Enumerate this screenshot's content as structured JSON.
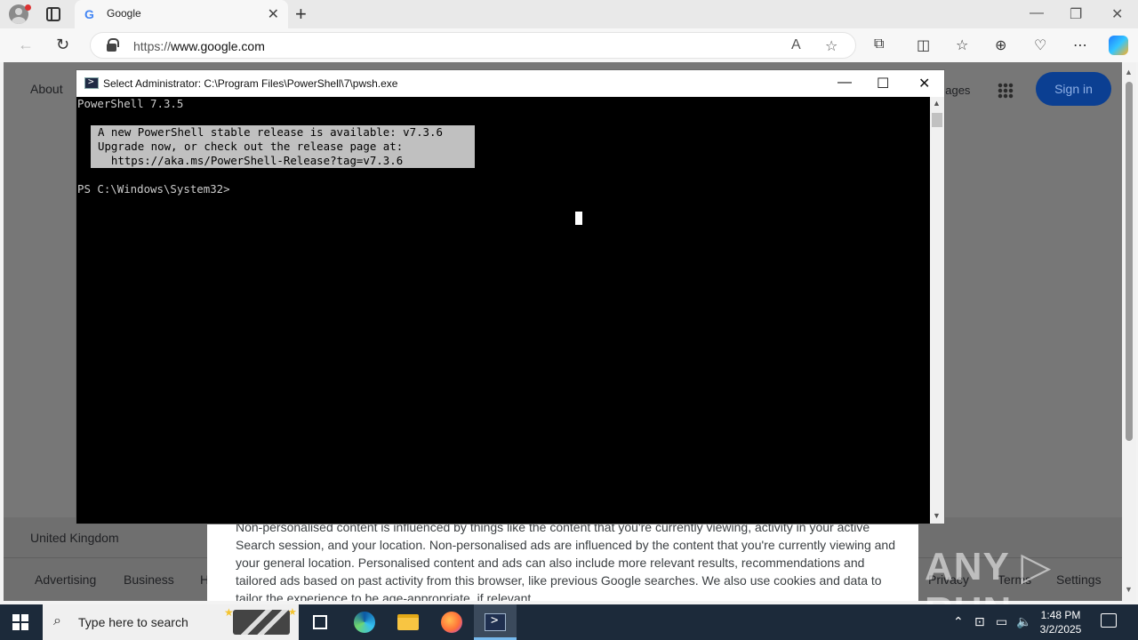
{
  "browser": {
    "tab_title": "Google",
    "tab_favicon": "G",
    "tab_close": "✕",
    "new_tab": "+",
    "url_prefix": "https://",
    "url_host": "www.google.com",
    "win_minimize": "—",
    "win_restore": "❐",
    "win_close": "✕"
  },
  "page": {
    "about": "About",
    "images": "nages",
    "signin": "Sign in",
    "country": "United Kingdom",
    "footer_links": [
      "Advertising",
      "Business",
      "H",
      "Privacy",
      "Terms",
      "Settings"
    ],
    "consent_text": "Non-personalised content is influenced by things like the content that you're currently viewing, activity in your active Search session, and your location. Non-personalised ads are influenced by the content that you're currently viewing and your general location. Personalised content and ads can also include more relevant results, recommendations and tailored ads based on past activity from this browser, like previous Google searches. We also use cookies and data to tailor the experience to be age-appropriate, if relevant."
  },
  "powershell": {
    "title": "Select Administrator: C:\\Program Files\\PowerShell\\7\\pwsh.exe",
    "version_line": "PowerShell 7.3.5",
    "notice_lines": [
      "A new PowerShell stable release is available: v7.3.6",
      "Upgrade now, or check out the release page at:",
      "  https://aka.ms/PowerShell-Release?tag=v7.3.6"
    ],
    "prompt": "PS C:\\Windows\\System32>",
    "ctrl_minimize": "—",
    "ctrl_maximize": "☐",
    "ctrl_close": "✕"
  },
  "watermark": "ANY ▷ RUN",
  "taskbar": {
    "search_placeholder": "Type here to search",
    "time": "1:48 PM",
    "date": "3/2/2025"
  },
  "colors": {
    "signin_bg": "#0b3f92",
    "taskbar_bg": "#1c2a3a",
    "notice_bg": "#c0c0c0"
  }
}
